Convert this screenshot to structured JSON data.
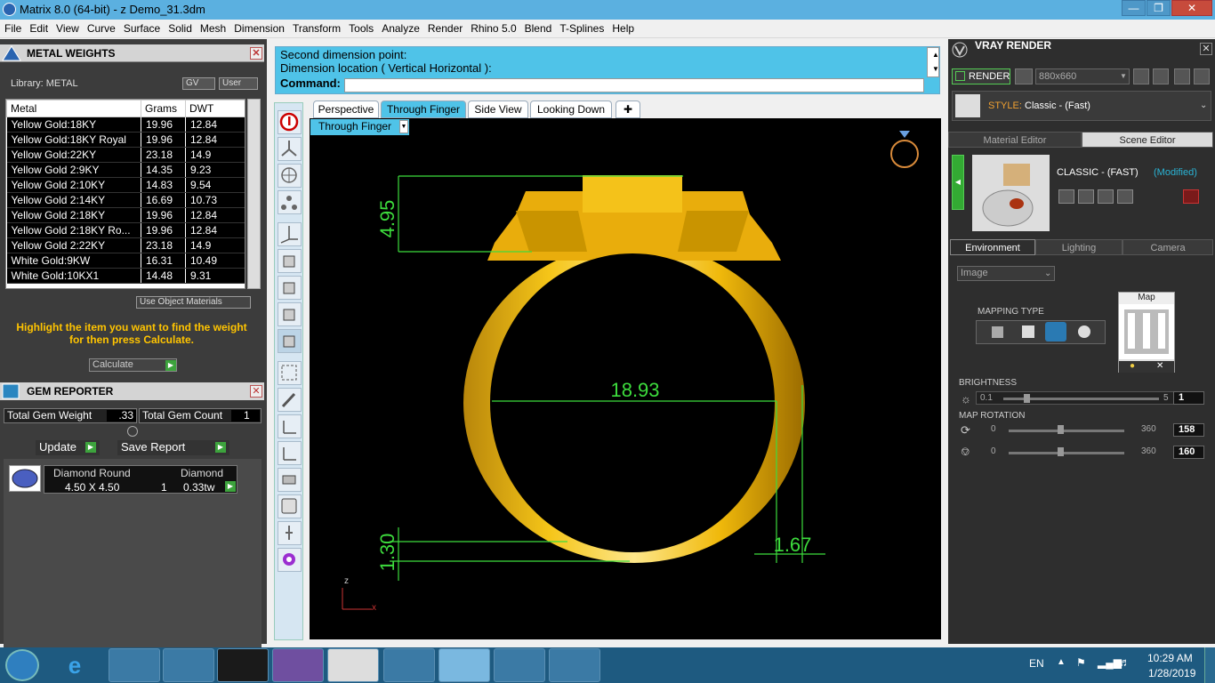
{
  "window": {
    "title": "Matrix 8.0 (64-bit) - z Demo_31.3dm"
  },
  "menu": [
    "File",
    "Edit",
    "View",
    "Curve",
    "Surface",
    "Solid",
    "Mesh",
    "Dimension",
    "Transform",
    "Tools",
    "Analyze",
    "Render",
    "Rhino 5.0",
    "Blend",
    "T-Splines",
    "Help"
  ],
  "metal_weights": {
    "title": "METAL WEIGHTS",
    "library_label": "Library: METAL",
    "gv_label": "GV",
    "user_label": "User",
    "columns": [
      "Metal",
      "Grams",
      "DWT"
    ],
    "rows": [
      [
        "Yellow Gold:18KY",
        "19.96",
        "12.84"
      ],
      [
        "Yellow Gold:18KY Royal",
        "19.96",
        "12.84"
      ],
      [
        "Yellow Gold:22KY",
        "23.18",
        "14.9"
      ],
      [
        "Yellow Gold 2:9KY",
        "14.35",
        "9.23"
      ],
      [
        "Yellow Gold 2:10KY",
        "14.83",
        "9.54"
      ],
      [
        "Yellow Gold 2:14KY",
        "16.69",
        "10.73"
      ],
      [
        "Yellow Gold 2:18KY",
        "19.96",
        "12.84"
      ],
      [
        "Yellow Gold 2:18KY Ro...",
        "19.96",
        "12.84"
      ],
      [
        "Yellow Gold 2:22KY",
        "23.18",
        "14.9"
      ],
      [
        "White Gold:9KW",
        "16.31",
        "10.49"
      ],
      [
        "White Gold:10KX1",
        "14.48",
        "9.31"
      ]
    ],
    "use_object_materials": "Use Object Materials",
    "hint": "Highlight the item you want to find the weight for then press Calculate.",
    "calculate_label": "Calculate"
  },
  "gem_reporter": {
    "title": "GEM REPORTER",
    "total_weight_label": "Total Gem Weight",
    "total_weight_value": ".33",
    "total_count_label": "Total Gem Count",
    "total_count_value": "1",
    "update_label": "Update",
    "save_label": "Save Report",
    "gem": {
      "shape": "Diamond Round",
      "type": "Diamond",
      "size": "4.50 X 4.50",
      "qty": "1",
      "weight": "0.33tw"
    }
  },
  "command": {
    "line1": "Second dimension point:",
    "line2": "Dimension location ( Vertical  Horizontal ):",
    "prompt": "Command:"
  },
  "viewport": {
    "tabs": [
      "Perspective",
      "Through Finger",
      "Side View",
      "Looking Down"
    ],
    "active_tab": "Through Finger",
    "dropdown_label": "Through Finger",
    "dimensions": {
      "top": "4.95",
      "inner": "18.93",
      "bottom_height": "1.30",
      "bottom_width": "1.67"
    },
    "axis_z": "z",
    "axis_x": "x"
  },
  "vray": {
    "title": "VRAY RENDER",
    "render_label": "RENDER",
    "resolution": "880x660",
    "style_label": "STYLE:",
    "style_value": "Classic - (Fast)",
    "editor_tabs": [
      "Material Editor",
      "Scene Editor"
    ],
    "preset_name": "CLASSIC - (FAST)",
    "preset_state": "(Modified)",
    "env_tabs": [
      "Environment",
      "Lighting",
      "Camera"
    ],
    "env_type": "Image",
    "map_label": "Map",
    "mapping_type_label": "MAPPING TYPE",
    "brightness": {
      "label": "BRIGHTNESS",
      "min": "0.1",
      "max": "5",
      "value": "1"
    },
    "map_rotation": {
      "label": "MAP ROTATION",
      "row1": {
        "min": "0",
        "max": "360",
        "value": "158"
      },
      "row2": {
        "min": "0",
        "max": "360",
        "value": "160"
      }
    }
  },
  "taskbar": {
    "lang": "EN",
    "time": "10:29 AM",
    "date": "1/28/2019"
  },
  "colors": {
    "cyan": "#4fc3e8",
    "gold": "#f5c518",
    "dim_green": "#3ddc3d",
    "accent_yellow": "#ffc400"
  }
}
